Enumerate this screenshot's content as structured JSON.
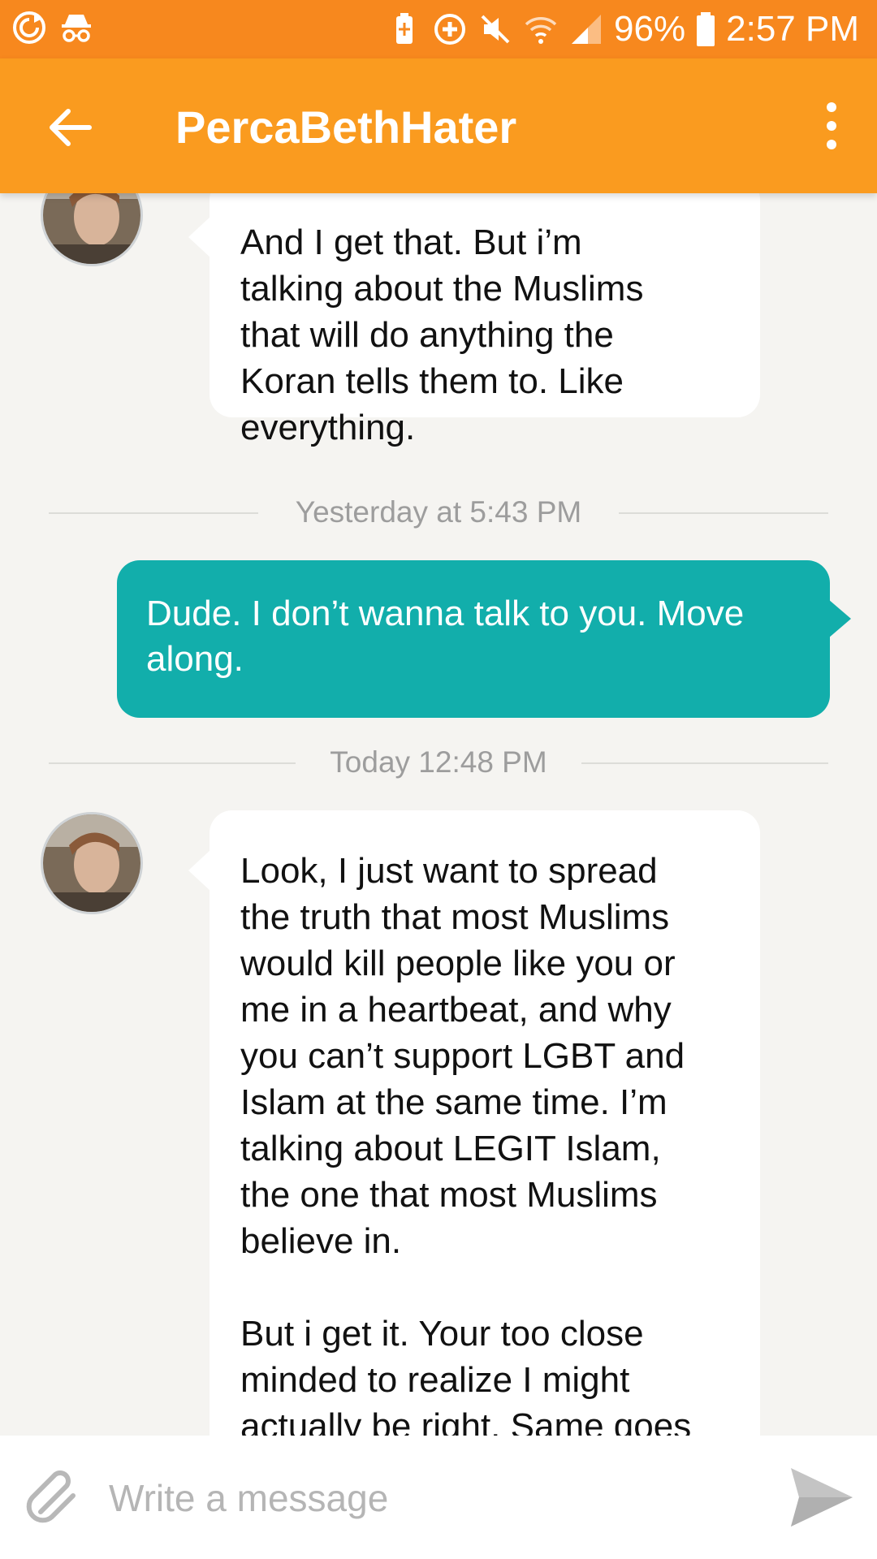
{
  "status_bar": {
    "battery_percent": "96%",
    "time": "2:57 PM",
    "icons": [
      "sync-icon",
      "incognito-icon",
      "battery-saver-icon",
      "add-circle-icon",
      "mute-icon",
      "wifi-icon",
      "signal-icon",
      "battery-icon"
    ]
  },
  "app_bar": {
    "title": "PercaBethHater",
    "icons": [
      "back-arrow-icon",
      "more-vert-icon"
    ]
  },
  "colors": {
    "status_bar": "#f7881e",
    "app_bar": "#fa9b1f",
    "outgoing_bubble": "#12aeab",
    "incoming_bubble": "#ffffff",
    "background": "#f5f4f1"
  },
  "messages": [
    {
      "direction": "incoming",
      "text": "And I get that. But i’m\ntalking about the Muslims\nthat will do anything the\nKoran tells them to. Like\neverything."
    },
    {
      "type": "time_separator",
      "text": "Yesterday at 5:43 PM"
    },
    {
      "direction": "outgoing",
      "text": "Dude. I don’t wanna talk to you. Move\nalong."
    },
    {
      "type": "time_separator",
      "text": "Today 12:48 PM"
    },
    {
      "direction": "incoming",
      "text": "Look, I just want to spread\nthe truth that most Muslims\nwould kill people like you or\nme in a heartbeat, and why\nyou can’t support LGBT and\nIslam at the same time. I’m\ntalking about LEGIT Islam,\nthe one that most Muslims\nbelieve in.\n\nBut i get it. Your too close\nminded to realize I might\nactually be right. Same goes"
    }
  ],
  "composer": {
    "placeholder": "Write a message",
    "value": "",
    "icons": [
      "attach-icon",
      "send-icon"
    ]
  }
}
